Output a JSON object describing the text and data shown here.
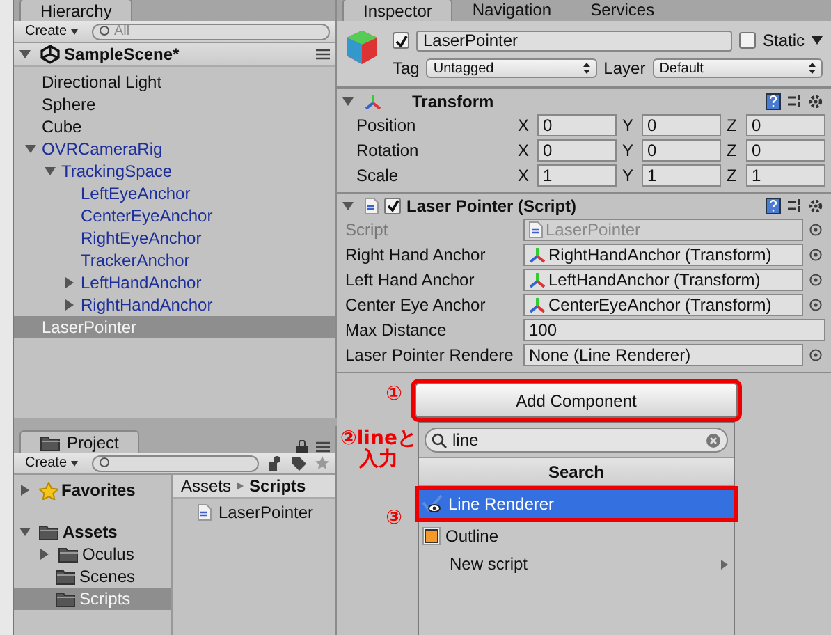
{
  "hierarchy": {
    "tab": "Hierarchy",
    "create": "Create",
    "search_placeholder": "All",
    "scene": {
      "name": "SampleScene*",
      "expanded": true
    },
    "items": [
      {
        "name": "Directional Light",
        "prefab": false,
        "selected": false
      },
      {
        "name": "Sphere",
        "prefab": false,
        "selected": false
      },
      {
        "name": "Cube",
        "prefab": false,
        "selected": false
      },
      {
        "name": "OVRCameraRig",
        "prefab": true,
        "selected": false,
        "expanded": true,
        "children": [
          {
            "name": "TrackingSpace",
            "prefab": true,
            "selected": false,
            "expanded": true,
            "children": [
              {
                "name": "LeftEyeAnchor",
                "prefab": true,
                "selected": false
              },
              {
                "name": "CenterEyeAnchor",
                "prefab": true,
                "selected": false
              },
              {
                "name": "RightEyeAnchor",
                "prefab": true,
                "selected": false
              },
              {
                "name": "TrackerAnchor",
                "prefab": true,
                "selected": false
              },
              {
                "name": "LeftHandAnchor",
                "prefab": true,
                "selected": false,
                "expanded": false
              },
              {
                "name": "RightHandAnchor",
                "prefab": true,
                "selected": false,
                "expanded": false
              }
            ]
          }
        ]
      },
      {
        "name": "LaserPointer",
        "prefab": false,
        "selected": true
      }
    ]
  },
  "project": {
    "tab": "Project",
    "create": "Create",
    "tree": [
      {
        "name": "Favorites",
        "kind": "favorites",
        "selected": false,
        "expanded": false
      },
      {
        "name": "Assets",
        "kind": "folder",
        "selected": false,
        "expanded": true,
        "children": [
          {
            "name": "Oculus",
            "kind": "folder",
            "selected": false,
            "expanded": false
          },
          {
            "name": "Scenes",
            "kind": "folder",
            "selected": false
          },
          {
            "name": "Scripts",
            "kind": "folder",
            "selected": true
          }
        ]
      }
    ],
    "breadcrumb": [
      "Assets",
      "Scripts"
    ],
    "files": [
      "LaserPointer"
    ]
  },
  "inspector": {
    "tabs": [
      {
        "label": "Inspector",
        "selected": true
      },
      {
        "label": "Navigation",
        "selected": false
      },
      {
        "label": "Services",
        "selected": false
      }
    ],
    "object": {
      "name": "LaserPointer",
      "active": true,
      "static": false,
      "static_label": "Static",
      "tag_label": "Tag",
      "tag": "Untagged",
      "layer_label": "Layer",
      "layer": "Default"
    },
    "components": [
      {
        "kind": "transform",
        "title": "Transform",
        "expanded": true,
        "rows": [
          {
            "label": "Position",
            "axes": [
              "X",
              "Y",
              "Z"
            ],
            "values": [
              "0",
              "0",
              "0"
            ]
          },
          {
            "label": "Rotation",
            "axes": [
              "X",
              "Y",
              "Z"
            ],
            "values": [
              "0",
              "0",
              "0"
            ]
          },
          {
            "label": "Scale",
            "axes": [
              "X",
              "Y",
              "Z"
            ],
            "values": [
              "1",
              "1",
              "1"
            ]
          }
        ]
      },
      {
        "kind": "script",
        "title": "Laser Pointer (Script)",
        "expanded": true,
        "enabled": true,
        "fields": [
          {
            "label": "Script",
            "value": "LaserPointer",
            "kind": "script",
            "disabled": true
          },
          {
            "label": "Right Hand Anchor",
            "value": "RightHandAnchor (Transform)",
            "kind": "transform",
            "disabled": false
          },
          {
            "label": "Left Hand Anchor",
            "value": "LeftHandAnchor (Transform)",
            "kind": "transform",
            "disabled": false
          },
          {
            "label": "Center Eye Anchor",
            "value": "CenterEyeAnchor (Transform)",
            "kind": "transform",
            "disabled": false
          },
          {
            "label": "Max Distance",
            "value": "100",
            "kind": "number",
            "disabled": false
          },
          {
            "label": "Laser Pointer Rendere",
            "value": "None (Line Renderer)",
            "kind": "none",
            "disabled": false
          }
        ]
      }
    ],
    "add_component": {
      "label": "Add Component",
      "highlighted": true,
      "search_value": "line",
      "section": "Search",
      "results": [
        {
          "name": "Line Renderer",
          "kind": "line-renderer",
          "selected": true,
          "highlighted": true
        },
        {
          "name": "Outline",
          "kind": "outline",
          "selected": false,
          "highlighted": false
        },
        {
          "name": "New script",
          "kind": "submenu",
          "selected": false,
          "highlighted": false
        }
      ]
    }
  },
  "annotations": [
    "①",
    "②lineと入力",
    "③"
  ]
}
